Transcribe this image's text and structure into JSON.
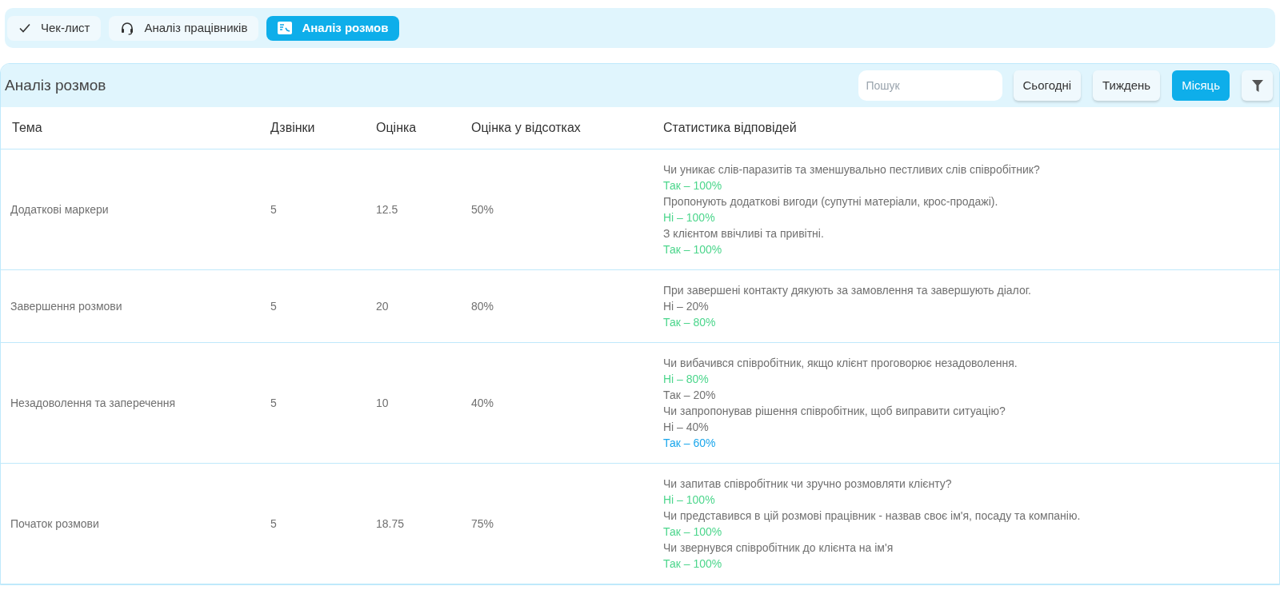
{
  "tabs": [
    {
      "label": "Чек-лист",
      "kind": "check",
      "selected": false
    },
    {
      "label": "Аналіз працівників",
      "kind": "headset",
      "selected": false
    },
    {
      "label": "Аналіз розмов",
      "kind": "card",
      "selected": true
    }
  ],
  "panel": {
    "title": "Аналіз розмов",
    "search": {
      "placeholder": "Пошук"
    },
    "periods": [
      {
        "label": "Сьогодні",
        "selected": false
      },
      {
        "label": "Тиждень",
        "selected": false
      },
      {
        "label": "Місяць",
        "selected": true
      }
    ]
  },
  "table": {
    "columns": [
      "Тема",
      "Дзвінки",
      "Оцінка",
      "Оцінка у відсотках",
      "Статистика відповідей"
    ],
    "rows": [
      {
        "topic": "Додаткові маркери",
        "calls": "5",
        "score": "12.5",
        "percent": "50%",
        "stats": [
          {
            "question": "Чи уникає слів-паразитів та зменшувально пестливих слів співробітник?",
            "answers": [
              {
                "text": "Так – 100%",
                "color": "#4cd68c"
              }
            ]
          },
          {
            "question": "Пропонують додаткові вигоди (супутні матеріали, крос-продажі).",
            "answers": [
              {
                "text": "Ні – 100%",
                "color": "#4cd68c"
              }
            ]
          },
          {
            "question": "З клієнтом ввічливі та привітні.",
            "answers": [
              {
                "text": "Так – 100%",
                "color": "#4cd68c"
              }
            ]
          }
        ]
      },
      {
        "topic": "Завершення розмови",
        "calls": "5",
        "score": "20",
        "percent": "80%",
        "stats": [
          {
            "question": "При завершені контакту дякують за замовлення та завершують діалог.",
            "answers": [
              {
                "text": "Ні – 20%",
                "color": "#727272"
              },
              {
                "text": "Так – 80%",
                "color": "#4cd68c"
              }
            ]
          }
        ]
      },
      {
        "topic": "Незадоволення та заперечення",
        "calls": "5",
        "score": "10",
        "percent": "40%",
        "stats": [
          {
            "question": "Чи вибачився співробітник, якщо клієнт проговорює незадоволення.",
            "answers": [
              {
                "text": "Ні – 80%",
                "color": "#4cd68c"
              },
              {
                "text": "Так – 20%",
                "color": "#727272"
              }
            ]
          },
          {
            "question": "Чи запропонував рішення співробітник, щоб виправити ситуацію?",
            "answers": [
              {
                "text": "Ні – 40%",
                "color": "#727272"
              },
              {
                "text": "Так – 60%",
                "color": "#1ba7ec"
              }
            ]
          }
        ]
      },
      {
        "topic": "Початок розмови",
        "calls": "5",
        "score": "18.75",
        "percent": "75%",
        "stats": [
          {
            "question": "Чи запитав співробітник чи зручно розмовляти клієнту?",
            "answers": [
              {
                "text": "Ні – 100%",
                "color": "#4cd68c"
              }
            ]
          },
          {
            "question": "Чи представився в цій розмові працівник - назвав своє ім'я, посаду та компанію.",
            "answers": [
              {
                "text": "Так – 100%",
                "color": "#4cd68c"
              }
            ]
          },
          {
            "question": "Чи звернувся співробітник до клієнта на ім'я",
            "answers": [
              {
                "text": "Так – 100%",
                "color": "#4cd68c"
              }
            ]
          }
        ]
      }
    ]
  }
}
